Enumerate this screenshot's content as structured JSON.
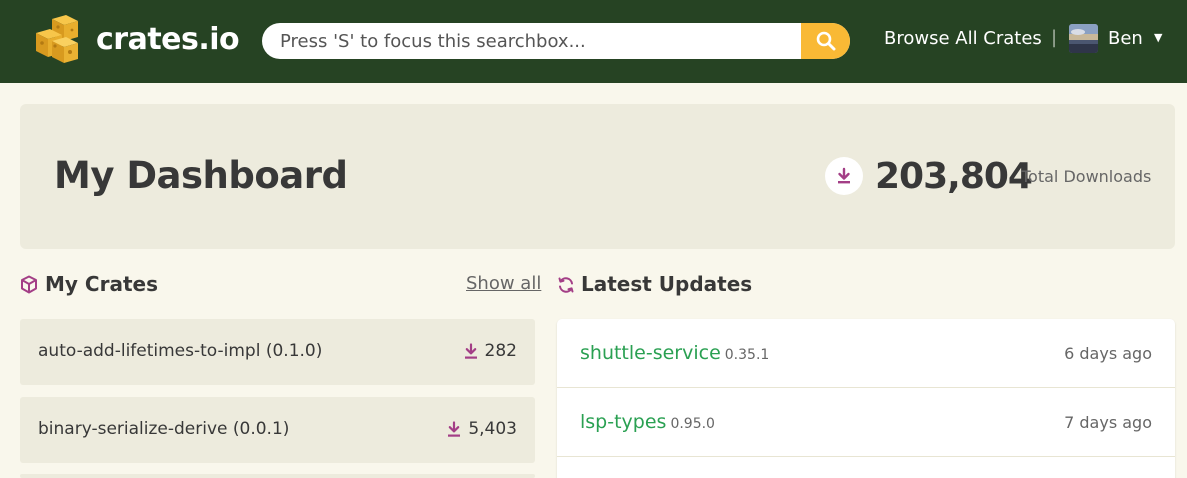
{
  "header": {
    "brand": "crates.io",
    "search_placeholder": "Press 'S' to focus this searchbox...",
    "browse_label": "Browse All Crates",
    "separator": "|",
    "user_name": "Ben",
    "caret": "▼"
  },
  "dashboard": {
    "title": "My Dashboard",
    "total_downloads": "203,804",
    "total_downloads_label": "Total Downloads"
  },
  "my_crates": {
    "title": "My Crates",
    "show_all": "Show all",
    "items": [
      {
        "name": "auto-add-lifetimes-to-impl (0.1.0)",
        "downloads": "282"
      },
      {
        "name": "binary-serialize-derive (0.0.1)",
        "downloads": "5,403"
      }
    ]
  },
  "latest_updates": {
    "title": "Latest Updates",
    "items": [
      {
        "name": "shuttle-service",
        "version": "0.35.1",
        "time": "6 days ago"
      },
      {
        "name": "lsp-types",
        "version": "0.95.0",
        "time": "7 days ago"
      }
    ]
  },
  "colors": {
    "header_bg": "#264323",
    "accent_yellow": "#f9b935",
    "crate_link_green": "#2aa052",
    "icon_purple": "#a33e86",
    "page_bg": "#f9f7ec",
    "panel_bg": "#edebdd"
  },
  "icons": {
    "logo": "crates-cube-logo-icon",
    "search": "search-icon",
    "download": "download-icon",
    "crates_section": "box-icon",
    "updates_section": "refresh-icon"
  }
}
